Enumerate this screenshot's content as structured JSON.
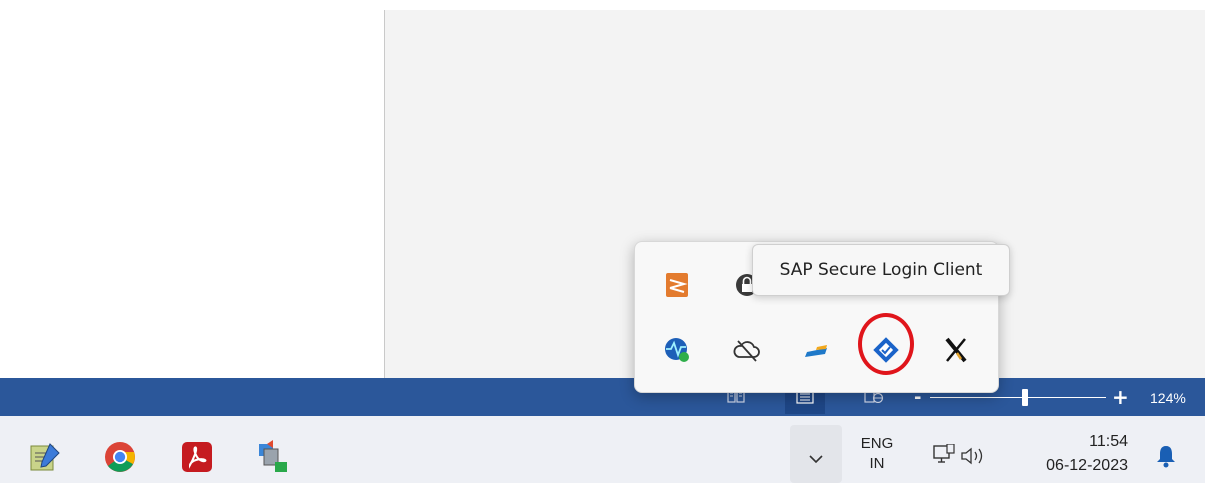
{
  "tray_popup": {
    "tooltip": "SAP Secure Login Client",
    "icons": [
      "sublime-text-icon",
      "lock-app-icon",
      "network-monitor-icon",
      "cloud-offline-icon",
      "sap-gui-icon",
      "sap-secure-login-icon",
      "x-app-icon"
    ]
  },
  "status_bar": {
    "zoom_level": "124%",
    "zoom_fraction": 0.52,
    "accent_color": "#2b579a"
  },
  "taskbar": {
    "apps": [
      "notepad-edit-icon",
      "chrome-icon",
      "acrobat-icon",
      "network-transfer-icon"
    ],
    "language": {
      "line1": "ENG",
      "line2": "IN"
    },
    "clock": {
      "time": "11:54",
      "date": "06-12-2023"
    }
  },
  "colors": {
    "highlight": "#e0151b",
    "taskbar_bg": "#eef0f5"
  }
}
